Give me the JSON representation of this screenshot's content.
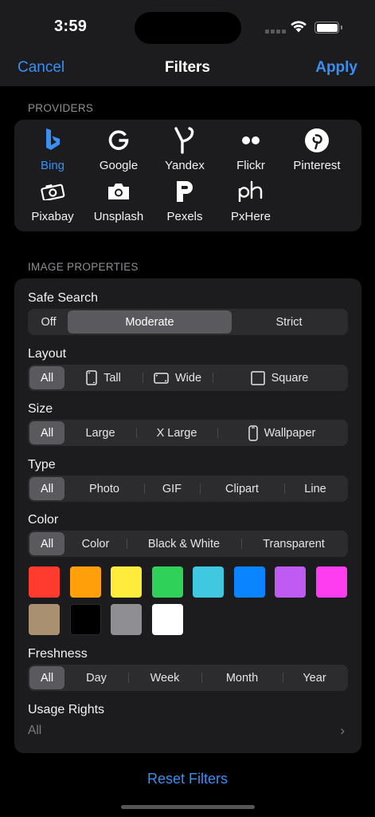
{
  "status": {
    "time": "3:59"
  },
  "nav": {
    "cancel": "Cancel",
    "title": "Filters",
    "apply": "Apply"
  },
  "providers_section": {
    "header": "PROVIDERS",
    "items": [
      {
        "label": "Bing",
        "icon": "bing-icon",
        "selected": true
      },
      {
        "label": "Google",
        "icon": "google-icon",
        "selected": false
      },
      {
        "label": "Yandex",
        "icon": "yandex-icon",
        "selected": false
      },
      {
        "label": "Flickr",
        "icon": "flickr-icon",
        "selected": false
      },
      {
        "label": "Pinterest",
        "icon": "pinterest-icon",
        "selected": false
      },
      {
        "label": "Pixabay",
        "icon": "pixabay-icon",
        "selected": false
      },
      {
        "label": "Unsplash",
        "icon": "unsplash-icon",
        "selected": false
      },
      {
        "label": "Pexels",
        "icon": "pexels-icon",
        "selected": false
      },
      {
        "label": "PxHere",
        "icon": "pxhere-icon",
        "selected": false
      }
    ]
  },
  "properties": {
    "header": "IMAGE PROPERTIES",
    "safe_search": {
      "label": "Safe Search",
      "options": [
        "Off",
        "Moderate",
        "Strict"
      ],
      "selected": "Moderate"
    },
    "layout": {
      "label": "Layout",
      "options": [
        "All",
        "Tall",
        "Wide",
        "Square"
      ],
      "selected": "All"
    },
    "size": {
      "label": "Size",
      "options": [
        "All",
        "Large",
        "X Large",
        "Wallpaper"
      ],
      "selected": "All"
    },
    "type": {
      "label": "Type",
      "options": [
        "All",
        "Photo",
        "GIF",
        "Clipart",
        "Line"
      ],
      "selected": "All"
    },
    "color": {
      "label": "Color",
      "options": [
        "All",
        "Color",
        "Black & White",
        "Transparent"
      ],
      "selected": "All",
      "swatches": [
        "#ff3b30",
        "#ff9f0a",
        "#ffeb3b",
        "#30d158",
        "#40c8e0",
        "#0a84ff",
        "#bf5af2",
        "#ff3df0",
        "#a89070",
        "#000000",
        "#8e8e93",
        "#ffffff"
      ]
    },
    "freshness": {
      "label": "Freshness",
      "options": [
        "All",
        "Day",
        "Week",
        "Month",
        "Year"
      ],
      "selected": "All"
    },
    "usage_rights": {
      "label": "Usage Rights",
      "value": "All"
    }
  },
  "reset_label": "Reset Filters"
}
